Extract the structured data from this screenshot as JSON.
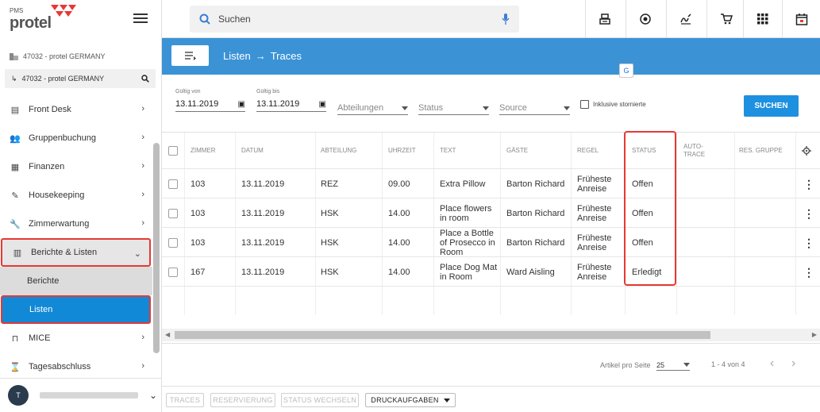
{
  "logo": {
    "small": "PMS",
    "main": "protel"
  },
  "property": {
    "current": "47032 - protel GERMANY",
    "selector": "47032 - protel GERMANY"
  },
  "nav": {
    "front_desk": "Front Desk",
    "group_booking": "Gruppenbuchung",
    "finance": "Finanzen",
    "housekeeping": "Housekeeping",
    "maintenance": "Zimmerwartung",
    "reports_lists": "Berichte & Listen",
    "reports": "Berichte",
    "lists": "Listen",
    "mice": "MICE",
    "day_close": "Tagesabschluss"
  },
  "user": {
    "initial": "T"
  },
  "search": {
    "placeholder": "Suchen"
  },
  "breadcrumb": {
    "parent": "Listen",
    "arrow": "→",
    "current": "Traces"
  },
  "filters": {
    "valid_from_label": "Gültig von",
    "valid_from_value": "13.11.2019",
    "valid_to_label": "Gültig bis",
    "valid_to_value": "13.11.2019",
    "department": "Abteilungen",
    "status": "Status",
    "source": "Source",
    "include_cancelled": "Inklusive stornierte",
    "search_button": "SUCHEN"
  },
  "table": {
    "headers": {
      "room": "ZIMMER",
      "date": "DATUM",
      "department": "ABTEILUNG",
      "time": "UHRZEIT",
      "text": "TEXT",
      "guests": "GÄSTE",
      "rule": "REGEL",
      "status": "STATUS",
      "auto_trace": "AUTO-\nTRACE",
      "res_group": "RES. GRUPPE"
    },
    "rows": [
      {
        "room": "103",
        "date": "13.11.2019",
        "department": "REZ",
        "time": "09.00",
        "text": "Extra Pillow",
        "guests": "Barton Richard",
        "rule": "Früheste Anreise",
        "status": "Offen"
      },
      {
        "room": "103",
        "date": "13.11.2019",
        "department": "HSK",
        "time": "14.00",
        "text": "Place flowers in room",
        "guests": "Barton Richard",
        "rule": "Früheste Anreise",
        "status": "Offen"
      },
      {
        "room": "103",
        "date": "13.11.2019",
        "department": "HSK",
        "time": "14.00",
        "text": "Place a Bottle of Prosecco in Room",
        "guests": "Barton Richard",
        "rule": "Früheste Anreise",
        "status": "Offen"
      },
      {
        "room": "167",
        "date": "13.11.2019",
        "department": "HSK",
        "time": "14.00",
        "text": "Place Dog Mat in Room",
        "guests": "Ward Aisling",
        "rule": "Früheste Anreise",
        "status": "Erledigt"
      }
    ]
  },
  "paginator": {
    "per_page_label": "Artikel pro Seite",
    "per_page": "25",
    "range": "1 - 4 von 4"
  },
  "actions": {
    "traces": "TRACES",
    "reservation": "RESERVIERUNG",
    "change_status": "STATUS WECHSELN",
    "print_tasks": "DRUCKAUFGABEN"
  },
  "colors": {
    "accent": "#3b93d6",
    "primary_button": "#1e90e0",
    "active_nav": "#1289d6",
    "highlight": "#e53935"
  }
}
